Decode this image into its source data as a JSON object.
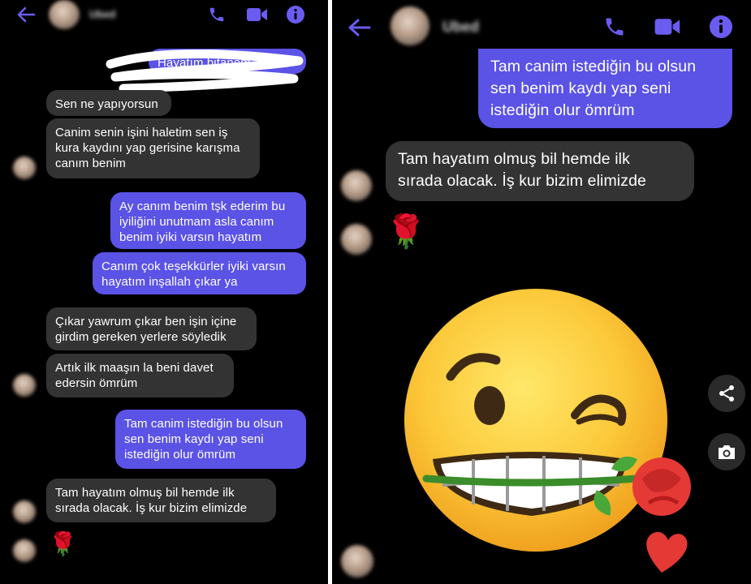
{
  "contact": {
    "name": "Ubed"
  },
  "colors": {
    "outgoing": "#5b52e6",
    "incoming": "#333333",
    "accent": "#6a5cf0",
    "background": "#000000"
  },
  "icons": [
    "back-arrow-icon",
    "phone-icon",
    "video-camera-icon",
    "info-icon",
    "share-icon",
    "camera-icon"
  ],
  "left": {
    "messages": [
      {
        "from": "me",
        "text": "Hayatım bitanem"
      },
      {
        "from": "them",
        "text": "Sen ne yapıyorsun"
      },
      {
        "from": "them",
        "text": "Canim senin işini haletim sen iş\nkura kaydını yap gerisine karışma\ncanım benim"
      },
      {
        "from": "me",
        "text": "Ay canım benim tşk ederim bu\niyiliğini unutmam asla canım\nbenim iyiki varsın hayatım"
      },
      {
        "from": "me",
        "text": "Canım çok teşekkürler iyiki varsın\nhayatım inşallah çıkar ya"
      },
      {
        "from": "them",
        "text": "Çıkar yawrum çıkar ben işin içine\ngirdim gereken yerlere söyledik"
      },
      {
        "from": "them",
        "text": "Artık ilk maaşın la beni davet\nedersin  ömrüm"
      },
      {
        "from": "me",
        "text": "Tam canim istediğin bu olsun\nsen benim kaydı yap seni\nistediğin olur ömrüm"
      },
      {
        "from": "them",
        "text": "Tam hayatım olmuş bil hemde ilk\nsırada olacak. İş kur bizim elimizde"
      },
      {
        "from": "them",
        "text": "🌹"
      }
    ]
  },
  "right": {
    "messages": [
      {
        "from": "me",
        "text": "Tam canim istediğin bu olsun\nsen benim kaydı yap seni\nistediğin olur ömrüm"
      },
      {
        "from": "them",
        "text": "Tam hayatım olmuş bil hemde ilk\nsırada olacak. İş kur bizim elimizde"
      },
      {
        "from": "them",
        "text": "🌹"
      }
    ],
    "sticker": "winking-grin-with-rose-emoji"
  }
}
